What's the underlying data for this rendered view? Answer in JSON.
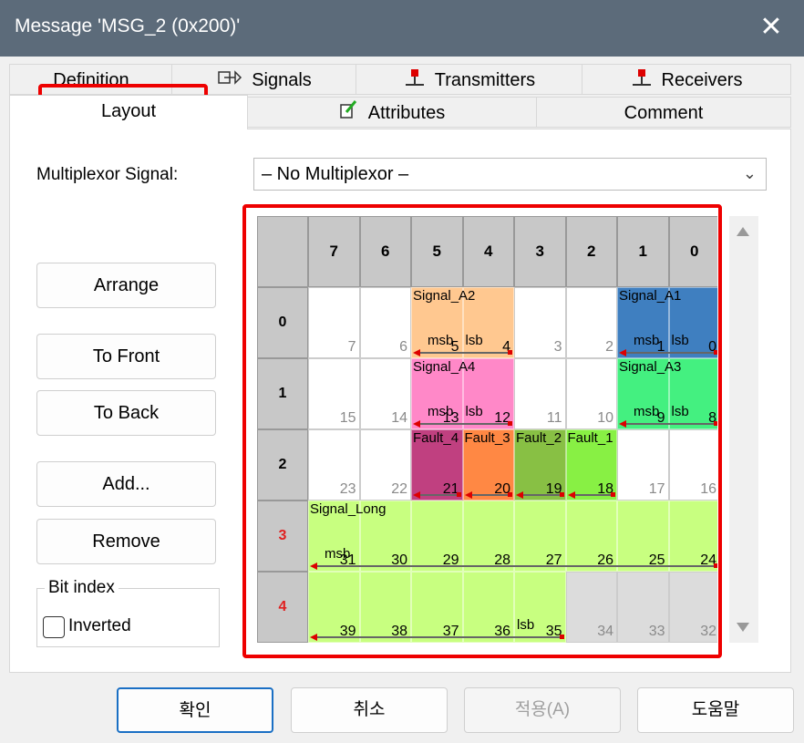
{
  "window": {
    "title": "Message 'MSG_2 (0x200)'",
    "close_glyph": "✕"
  },
  "tabs_row1": [
    {
      "label": "Definition",
      "icon": ""
    },
    {
      "label": "Signals",
      "icon": "signals-icon"
    },
    {
      "label": "Transmitters",
      "icon": "transmitter-icon"
    },
    {
      "label": "Receivers",
      "icon": "receiver-icon"
    }
  ],
  "tabs_row2": [
    {
      "label": "Layout",
      "active": true
    },
    {
      "label": "Attributes",
      "icon": "attributes-icon"
    },
    {
      "label": "Comment"
    }
  ],
  "multiplexor": {
    "label": "Multiplexor Signal:",
    "value": "– No Multiplexor –"
  },
  "buttons": {
    "arrange": "Arrange",
    "to_front": "To Front",
    "to_back": "To Back",
    "add": "Add...",
    "remove": "Remove"
  },
  "bit_index": {
    "caption": "Bit index",
    "inverted_label": "Inverted",
    "inverted": false
  },
  "layout_grid": {
    "col_headers": [
      "7",
      "6",
      "5",
      "4",
      "3",
      "2",
      "1",
      "0"
    ],
    "row_headers": [
      "0",
      "1",
      "2",
      "3",
      "4"
    ],
    "highlight_rows": [
      3,
      4
    ],
    "cells": [
      [
        "7",
        "6",
        "5",
        "4",
        "3",
        "2",
        "1",
        "0"
      ],
      [
        "15",
        "14",
        "13",
        "12",
        "11",
        "10",
        "9",
        "8"
      ],
      [
        "23",
        "22",
        "21",
        "20",
        "19",
        "18",
        "17",
        "16"
      ],
      [
        "31",
        "30",
        "29",
        "28",
        "27",
        "26",
        "25",
        "24"
      ],
      [
        "39",
        "38",
        "37",
        "36",
        "35",
        "34",
        "33",
        "32"
      ]
    ],
    "signals": [
      {
        "name": "Signal_A2",
        "color": "#ffc890",
        "cells": [
          [
            0,
            2
          ],
          [
            0,
            3
          ]
        ],
        "msb": "msb",
        "lsb": "lsb"
      },
      {
        "name": "Signal_A1",
        "color": "#3f7fc0",
        "cells": [
          [
            0,
            6
          ],
          [
            0,
            7
          ]
        ],
        "msb": "msb",
        "lsb": "lsb"
      },
      {
        "name": "Signal_A4",
        "color": "#ff88c8",
        "cells": [
          [
            1,
            2
          ],
          [
            1,
            3
          ]
        ],
        "msb": "msb",
        "lsb": "lsb"
      },
      {
        "name": "Signal_A3",
        "color": "#44f080",
        "cells": [
          [
            1,
            6
          ],
          [
            1,
            7
          ]
        ],
        "msb": "msb",
        "lsb": "lsb"
      },
      {
        "name": "Fault_4",
        "color": "#c04080",
        "cells": [
          [
            2,
            2
          ]
        ]
      },
      {
        "name": "Fault_3",
        "color": "#ff8844",
        "cells": [
          [
            2,
            3
          ]
        ]
      },
      {
        "name": "Fault_2",
        "color": "#88c044",
        "cells": [
          [
            2,
            4
          ]
        ]
      },
      {
        "name": "Fault_1",
        "color": "#88f044",
        "cells": [
          [
            2,
            5
          ]
        ]
      },
      {
        "name": "Signal_Long",
        "color": "#c8ff80",
        "cells": [
          [
            3,
            0
          ],
          [
            3,
            1
          ],
          [
            3,
            2
          ],
          [
            3,
            3
          ],
          [
            3,
            4
          ],
          [
            3,
            5
          ],
          [
            3,
            6
          ],
          [
            3,
            7
          ],
          [
            4,
            0
          ],
          [
            4,
            1
          ],
          [
            4,
            2
          ],
          [
            4,
            3
          ],
          [
            4,
            4
          ]
        ],
        "msb": "msb",
        "lsb": "lsb"
      }
    ]
  },
  "footer": {
    "ok": "확인",
    "cancel": "취소",
    "apply": "적용(A)",
    "help": "도움말"
  },
  "colors": {
    "titlebar": "#5c6b7a",
    "highlight": "#ff0000"
  }
}
